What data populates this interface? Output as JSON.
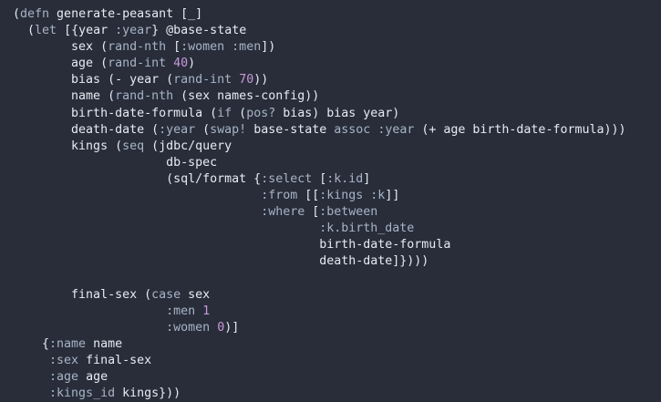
{
  "editor": {
    "background": "#292d3a",
    "colors": {
      "default_text": "#e4ecf2",
      "keyword": "#a6b4c6",
      "number": "#c79ad8"
    },
    "lines": [
      [
        {
          "t": "(",
          "c": "paren"
        },
        {
          "t": "defn",
          "c": "core"
        },
        {
          "t": " generate-peasant [_]",
          "c": "sym"
        }
      ],
      [
        {
          "t": "  (",
          "c": "paren"
        },
        {
          "t": "let",
          "c": "core"
        },
        {
          "t": " [{year ",
          "c": "sym"
        },
        {
          "t": ":year",
          "c": "kw"
        },
        {
          "t": "} @base-state",
          "c": "sym"
        }
      ],
      [
        {
          "t": "        sex (",
          "c": "sym"
        },
        {
          "t": "rand-nth",
          "c": "core"
        },
        {
          "t": " [",
          "c": "sym"
        },
        {
          "t": ":women :men",
          "c": "kw"
        },
        {
          "t": "])",
          "c": "sym"
        }
      ],
      [
        {
          "t": "        age (",
          "c": "sym"
        },
        {
          "t": "rand-int",
          "c": "core"
        },
        {
          "t": " ",
          "c": "sym"
        },
        {
          "t": "40",
          "c": "num"
        },
        {
          "t": ")",
          "c": "sym"
        }
      ],
      [
        {
          "t": "        bias (- year (",
          "c": "sym"
        },
        {
          "t": "rand-int",
          "c": "core"
        },
        {
          "t": " ",
          "c": "sym"
        },
        {
          "t": "70",
          "c": "num"
        },
        {
          "t": "))",
          "c": "sym"
        }
      ],
      [
        {
          "t": "        name (",
          "c": "sym"
        },
        {
          "t": "rand-nth",
          "c": "core"
        },
        {
          "t": " (sex names-config))",
          "c": "sym"
        }
      ],
      [
        {
          "t": "        birth-date-formula (",
          "c": "sym"
        },
        {
          "t": "if",
          "c": "core"
        },
        {
          "t": " (",
          "c": "sym"
        },
        {
          "t": "pos?",
          "c": "core"
        },
        {
          "t": " bias) bias year)",
          "c": "sym"
        }
      ],
      [
        {
          "t": "        death-date (",
          "c": "sym"
        },
        {
          "t": ":year",
          "c": "kw"
        },
        {
          "t": " (",
          "c": "sym"
        },
        {
          "t": "swap!",
          "c": "core"
        },
        {
          "t": " base-state ",
          "c": "sym"
        },
        {
          "t": "assoc",
          "c": "core"
        },
        {
          "t": " ",
          "c": "sym"
        },
        {
          "t": ":year",
          "c": "kw"
        },
        {
          "t": " (+ age birth-date-formula)))",
          "c": "sym"
        }
      ],
      [
        {
          "t": "        kings (",
          "c": "sym"
        },
        {
          "t": "seq",
          "c": "core"
        },
        {
          "t": " (jdbc/query",
          "c": "sym"
        }
      ],
      [
        {
          "t": "                     db-spec",
          "c": "sym"
        }
      ],
      [
        {
          "t": "                     (sql/format {",
          "c": "sym"
        },
        {
          "t": ":select",
          "c": "kw"
        },
        {
          "t": " [",
          "c": "sym"
        },
        {
          "t": ":k.id",
          "c": "kw"
        },
        {
          "t": "]",
          "c": "sym"
        }
      ],
      [
        {
          "t": "                                  ",
          "c": "sym"
        },
        {
          "t": ":from",
          "c": "kw"
        },
        {
          "t": " [[",
          "c": "sym"
        },
        {
          "t": ":kings :k",
          "c": "kw"
        },
        {
          "t": "]]",
          "c": "sym"
        }
      ],
      [
        {
          "t": "                                  ",
          "c": "sym"
        },
        {
          "t": ":where",
          "c": "kw"
        },
        {
          "t": " [",
          "c": "sym"
        },
        {
          "t": ":between",
          "c": "kw"
        }
      ],
      [
        {
          "t": "                                          ",
          "c": "sym"
        },
        {
          "t": ":k.birth_date",
          "c": "kw"
        }
      ],
      [
        {
          "t": "                                          birth-date-formula",
          "c": "sym"
        }
      ],
      [
        {
          "t": "                                          death-date]})))",
          "c": "sym"
        }
      ],
      [
        {
          "t": "",
          "c": "sym"
        }
      ],
      [
        {
          "t": "        final-sex (",
          "c": "sym"
        },
        {
          "t": "case",
          "c": "core"
        },
        {
          "t": " sex",
          "c": "sym"
        }
      ],
      [
        {
          "t": "                     ",
          "c": "sym"
        },
        {
          "t": ":men",
          "c": "kw"
        },
        {
          "t": " ",
          "c": "sym"
        },
        {
          "t": "1",
          "c": "num"
        }
      ],
      [
        {
          "t": "                     ",
          "c": "sym"
        },
        {
          "t": ":women",
          "c": "kw"
        },
        {
          "t": " ",
          "c": "sym"
        },
        {
          "t": "0",
          "c": "num"
        },
        {
          "t": ")]",
          "c": "sym"
        }
      ],
      [
        {
          "t": "    {",
          "c": "sym"
        },
        {
          "t": ":name",
          "c": "kw"
        },
        {
          "t": " name",
          "c": "sym"
        }
      ],
      [
        {
          "t": "     ",
          "c": "sym"
        },
        {
          "t": ":sex",
          "c": "kw"
        },
        {
          "t": " final-sex",
          "c": "sym"
        }
      ],
      [
        {
          "t": "     ",
          "c": "sym"
        },
        {
          "t": ":age",
          "c": "kw"
        },
        {
          "t": " age",
          "c": "sym"
        }
      ],
      [
        {
          "t": "     ",
          "c": "sym"
        },
        {
          "t": ":kings_id",
          "c": "kw"
        },
        {
          "t": " kings}))",
          "c": "sym"
        }
      ]
    ]
  }
}
